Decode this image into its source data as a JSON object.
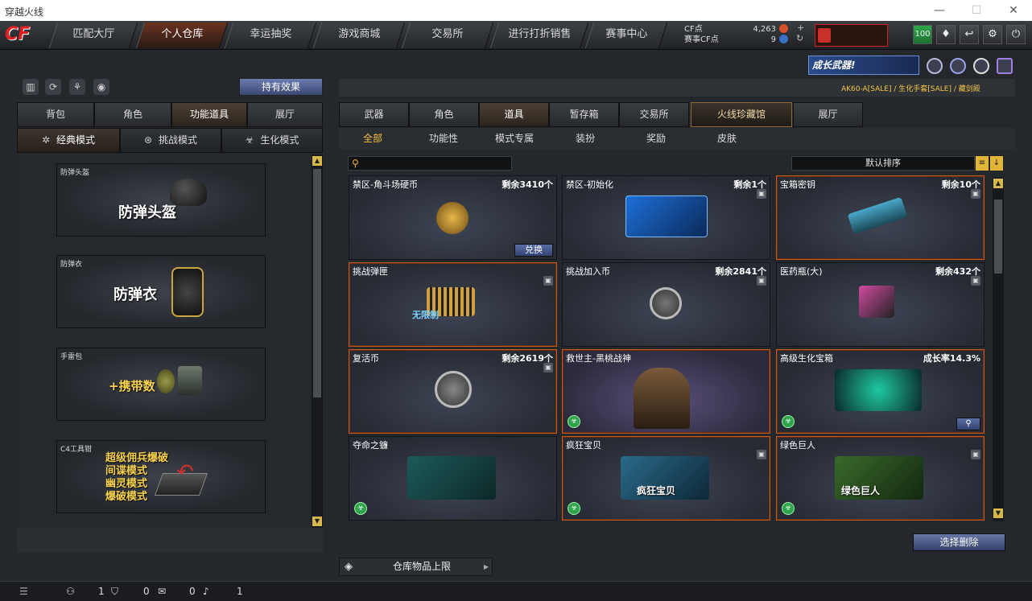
{
  "window": {
    "title": "穿越火线",
    "minimize": "—",
    "maximize": "☐",
    "close": "✕"
  },
  "logo": "CF",
  "nav": {
    "tabs": [
      "匹配大厅",
      "个人仓库",
      "幸运抽奖",
      "游戏商城",
      "交易所",
      "进行打折销售",
      "赛事中心"
    ],
    "active_index": 1
  },
  "currency": {
    "cf_label": "CF点",
    "cf_value": "4,263",
    "match_label": "赛事CF点",
    "match_value": "9"
  },
  "right_buttons": [
    "100",
    "♦",
    "↩",
    "⚙",
    "⏻"
  ],
  "left": {
    "hold_effect": "持有效果",
    "tabs": [
      "背包",
      "角色",
      "功能道具",
      "展厅"
    ],
    "tabs_active": 2,
    "modes": [
      "经典模式",
      "挑战模式",
      "生化模式"
    ],
    "modes_active": 0,
    "mode_icons": [
      "✲",
      "⊛",
      "☣"
    ],
    "items": [
      {
        "caption": "防弹头盔",
        "big": "防弹头盔"
      },
      {
        "caption": "防弹衣",
        "big": "防弹衣"
      },
      {
        "caption": "手雷包",
        "big": "+携带数"
      },
      {
        "caption": "C4工具钳",
        "modes": [
          "超级佣兵爆破",
          "间谍模式",
          "幽灵模式",
          "爆破模式"
        ]
      }
    ]
  },
  "right": {
    "promo": "成长武器!",
    "marquee": "AK60-A[SALE] / 生化手套[SALE] / 藏剑殿",
    "tabs": [
      "武器",
      "角色",
      "道具",
      "暂存箱",
      "交易所",
      "火线珍藏馆",
      "展厅"
    ],
    "tabs_active": 2,
    "subtabs": [
      "全部",
      "功能性",
      "模式专属",
      "装扮",
      "奖励",
      "皮肤"
    ],
    "subtabs_active": 0,
    "search_placeholder": "",
    "sort_label": "默认排序",
    "cards": [
      {
        "name": "禁区-角斗场硬币",
        "remain": "剩余3410个",
        "action": "兑换"
      },
      {
        "name": "禁区-初始化",
        "remain": "剩余1个"
      },
      {
        "name": "宝箱密钥",
        "remain": "剩余10个"
      },
      {
        "name": "挑战弹匣",
        "remain": "",
        "pic_text": "无限制"
      },
      {
        "name": "挑战加入币",
        "remain": "剩余2841个"
      },
      {
        "name": "医药瓶(大)",
        "remain": "剩余432个"
      },
      {
        "name": "复活币",
        "remain": "剩余2619个"
      },
      {
        "name": "救世主-黑桃战神",
        "remain": ""
      },
      {
        "name": "高级生化宝箱",
        "remain": "成长率14.3%"
      },
      {
        "name": "夺命之镰",
        "remain": ""
      },
      {
        "name": "疯狂宝贝",
        "remain": "",
        "pic_text": "疯狂宝贝"
      },
      {
        "name": "绿色巨人",
        "remain": "",
        "pic_text": "绿色巨人"
      }
    ],
    "select_delete": "选择删除",
    "warehouse_limit": "仓库物品上限"
  },
  "status": {
    "friends": "1",
    "shield": "0",
    "chat": "0",
    "volume": "1"
  }
}
